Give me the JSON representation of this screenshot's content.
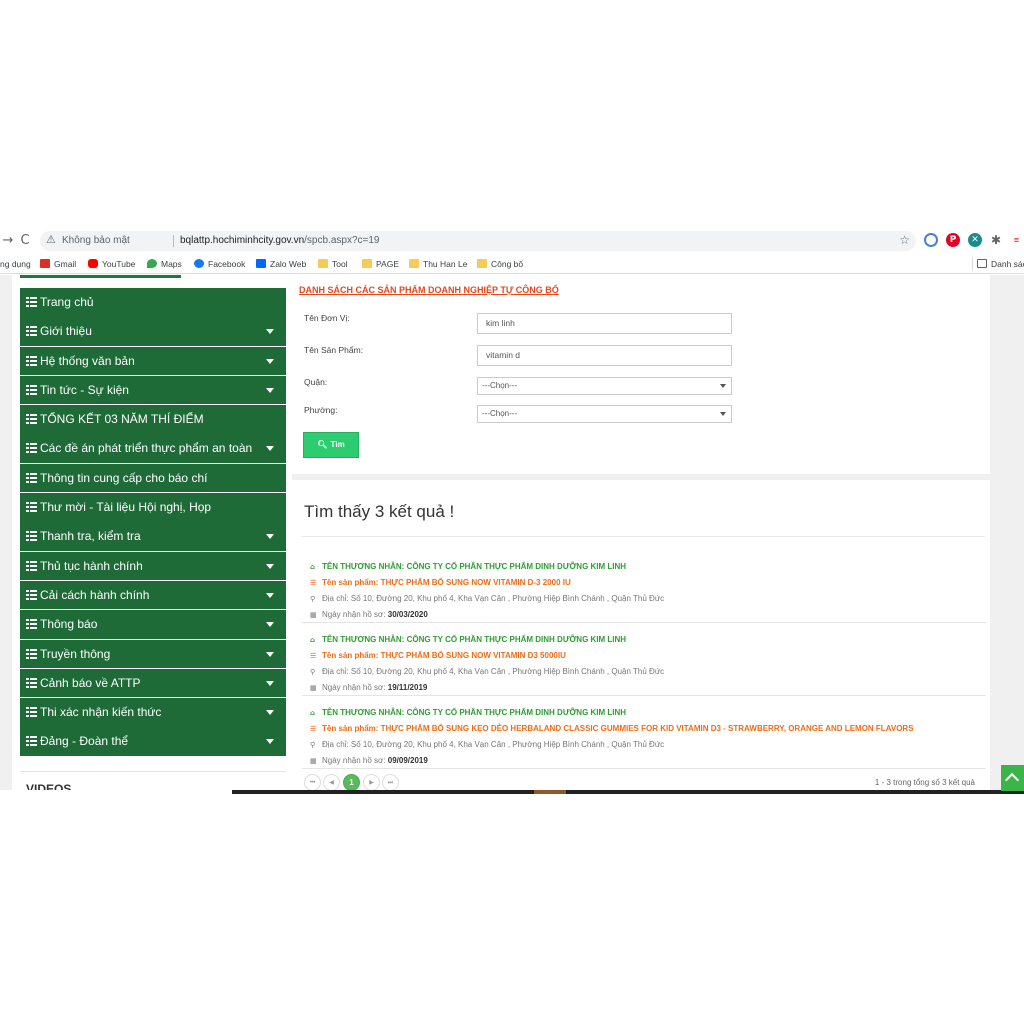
{
  "browser": {
    "back_glyph": "→",
    "reload_glyph": "C",
    "insecure_label": "Không bảo mật",
    "url_host": "bqlattp.hochiminhcity.gov.vn",
    "url_path": "/spcb.aspx?c=19",
    "bookmarks": [
      {
        "label": "ng dụng",
        "icon": "apps-icon"
      },
      {
        "label": "Gmail",
        "icon": "gmail-icon",
        "color": "#d93025"
      },
      {
        "label": "YouTube",
        "icon": "youtube-icon",
        "color": "#ff0000"
      },
      {
        "label": "Maps",
        "icon": "maps-icon",
        "color": "#34a853"
      },
      {
        "label": "Facebook",
        "icon": "facebook-icon",
        "color": "#1877f2"
      },
      {
        "label": "Zalo Web",
        "icon": "zalo-icon",
        "color": "#0068ff"
      },
      {
        "label": "Tool",
        "icon": "folder-icon"
      },
      {
        "label": "PAGE",
        "icon": "folder-icon"
      },
      {
        "label": "Thu Han Le",
        "icon": "folder-icon"
      },
      {
        "label": "Công bố",
        "icon": "folder-icon"
      }
    ],
    "reading_list_label": "Danh sác"
  },
  "sidebar": {
    "items": [
      {
        "label": "Trang chủ",
        "has_caret": false
      },
      {
        "label": "Giới thiệu",
        "has_caret": true
      },
      {
        "label": "Hệ thống văn bản",
        "has_caret": true
      },
      {
        "label": "Tin tức - Sự kiện",
        "has_caret": true
      },
      {
        "label": "TỔNG KẾT 03 NĂM THÍ ĐIỂM",
        "has_caret": false
      },
      {
        "label": "Các đề án phát triển thực phẩm an toàn",
        "has_caret": true
      },
      {
        "label": "Thông tin cung cấp cho báo chí",
        "has_caret": false
      },
      {
        "label": "Thư mời - Tài liệu Hội nghị, Họp",
        "has_caret": false
      },
      {
        "label": "Thanh tra, kiểm tra",
        "has_caret": true
      },
      {
        "label": "Thủ tục hành chính",
        "has_caret": true
      },
      {
        "label": "Cải cách hành chính",
        "has_caret": true
      },
      {
        "label": "Thông báo",
        "has_caret": true
      },
      {
        "label": "Truyền thông",
        "has_caret": true
      },
      {
        "label": "Cảnh báo về ATTP",
        "has_caret": true
      },
      {
        "label": "Thi xác nhận kiến thức",
        "has_caret": true
      },
      {
        "label": "Đảng - Đoàn thể",
        "has_caret": true
      }
    ],
    "videos_label": "VIDEOS",
    "menu_color": "#1e6b38"
  },
  "search": {
    "title": "DANH SÁCH CÁC SẢN PHẨM DOANH NGHIỆP TỰ CÔNG BỐ",
    "unit_label": "Tên Đơn Vị:",
    "unit_value": "kim linh",
    "product_label": "Tên Sản Phẩm:",
    "product_value": "vitamin d",
    "district_label": "Quận:",
    "district_value": "---Chọn---",
    "ward_label": "Phường:",
    "ward_value": "---Chọn---",
    "button_label": "Tìm"
  },
  "results": {
    "heading": "Tìm thấy 3 kết quả !",
    "items": [
      {
        "merchant": "TÊN THƯƠNG NHÂN: CÔNG TY CỔ PHẦN THỰC PHẨM DINH DƯỠNG KIM LINH",
        "product": "Tên sản phẩm: THỰC PHẨM BỔ SUNG NOW VITAMIN D-3 2000 IU",
        "address": "Địa chỉ: Số 10, Đường 20, Khu phố 4, Kha Vạn Cân , Phường Hiệp Bình Chánh , Quận Thủ Đức",
        "date_label": "Ngày nhận hồ sơ:",
        "date": "30/03/2020"
      },
      {
        "merchant": "TÊN THƯƠNG NHÂN: CÔNG TY CỔ PHẦN THỰC PHẨM DINH DƯỠNG KIM LINH",
        "product": "Tên sản phẩm: THỰC PHẨM BỔ SUNG NOW VITAMIN D3 5000IU",
        "address": "Địa chỉ: Số 10, Đường 20, Khu phố 4, Kha Vạn Cân , Phường Hiệp Bình Chánh , Quận Thủ Đức",
        "date_label": "Ngày nhận hồ sơ:",
        "date": "19/11/2019"
      },
      {
        "merchant": "TÊN THƯƠNG NHÂN: CÔNG TY CỔ PHẦN THỰC PHẨM DINH DƯỠNG KIM LINH",
        "product": "Tên sản phẩm: THỰC PHẨM BỔ SUNG KẸO DẺO HERBALAND CLASSIC GUMMIES FOR KID VITAMIN D3 - STRAWBERRY, ORANGE AND LEMON FLAVORS",
        "address": "Địa chỉ: Số 10, Đường 20, Khu phố 4, Kha Vạn Cân , Phường Hiệp Bình Chánh , Quận Thủ Đức",
        "date_label": "Ngày nhận hồ sơ:",
        "date": "09/09/2019"
      }
    ],
    "pager": {
      "first": "⏮",
      "prev": "◀",
      "current": "1",
      "next": "▶",
      "last": "⏭",
      "info": "1 - 3 trong tổng số 3 kết quả"
    }
  }
}
